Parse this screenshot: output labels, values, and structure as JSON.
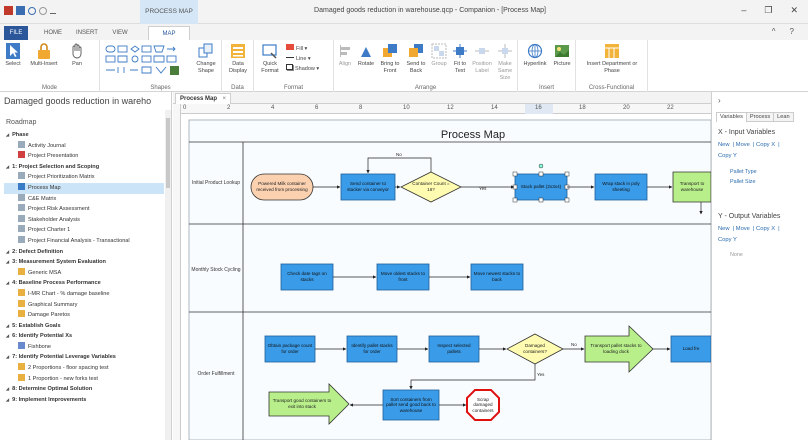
{
  "window": {
    "title": "Damaged goods reduction in warehouse.qcp - Companion - [Process Map]",
    "context_tab": "PROCESS MAP",
    "controls": [
      "–",
      "❐",
      "✕"
    ]
  },
  "ribbon_tabs": [
    "FILE",
    "HOME",
    "INSERT",
    "VIEW",
    "MAP"
  ],
  "ribbon_tabs_right": [
    "^",
    "?"
  ],
  "ribbon": {
    "groups": [
      {
        "label": "Mode",
        "buttons": [
          "Select",
          "Multi-Insert",
          "Pan"
        ]
      },
      {
        "label": "Shapes",
        "buttons": [
          "Change Shape"
        ]
      },
      {
        "label": "Data",
        "buttons": [
          "Data Display"
        ]
      },
      {
        "label": "Format",
        "buttons": [
          "Quick Format",
          "Fill",
          "Line",
          "Shadow"
        ]
      },
      {
        "label": "Arrange",
        "buttons": [
          "Align",
          "Rotate",
          "Bring to Front",
          "Send to Back",
          "Group",
          "Fit to Text",
          "Position Label",
          "Make Same Size"
        ]
      },
      {
        "label": "Insert",
        "buttons": [
          "Hyperlink",
          "Picture"
        ]
      },
      {
        "label": "Cross-Functional",
        "buttons": [
          "Insert Department or Phase"
        ]
      }
    ]
  },
  "left_pane": {
    "title": "Damaged goods reduction in wareho",
    "roadmap_label": "Roadmap",
    "tree": [
      {
        "label": "Phase",
        "level": 0,
        "type": "section"
      },
      {
        "label": "Activity Journal",
        "level": 1,
        "type": "doc"
      },
      {
        "label": "Project Presentation",
        "level": 1,
        "type": "pres"
      },
      {
        "label": "1: Project Selection and Scoping",
        "level": 0,
        "type": "section"
      },
      {
        "label": "Project Prioritization Matrix",
        "level": 1,
        "type": "doc"
      },
      {
        "label": "Process Map",
        "level": 1,
        "type": "map",
        "selected": true
      },
      {
        "label": "C&E Matrix",
        "level": 1,
        "type": "doc"
      },
      {
        "label": "Project Risk Assessment",
        "level": 1,
        "type": "doc"
      },
      {
        "label": "Stakeholder Analysis",
        "level": 1,
        "type": "doc"
      },
      {
        "label": "Project Charter 1",
        "level": 1,
        "type": "doc"
      },
      {
        "label": "Project Financial Analysis - Transactional",
        "level": 1,
        "type": "doc"
      },
      {
        "label": "2: Defect Definition",
        "level": 0,
        "type": "section"
      },
      {
        "label": "3: Measurement System Evaluation",
        "level": 0,
        "type": "section"
      },
      {
        "label": "Generic MSA",
        "level": 1,
        "type": "graph"
      },
      {
        "label": "4: Baseline Process Performance",
        "level": 0,
        "type": "section"
      },
      {
        "label": "I-MR Chart - % damage baseline",
        "level": 1,
        "type": "graph"
      },
      {
        "label": "Graphical Summary",
        "level": 1,
        "type": "graph"
      },
      {
        "label": "Damage Paretos",
        "level": 1,
        "type": "graph"
      },
      {
        "label": "5: Establish Goals",
        "level": 0,
        "type": "section"
      },
      {
        "label": "6: Identify Potential Xs",
        "level": 0,
        "type": "section"
      },
      {
        "label": "Fishbone",
        "level": 1,
        "type": "fish"
      },
      {
        "label": "7: Identify Potential Leverage Variables",
        "level": 0,
        "type": "section"
      },
      {
        "label": "2 Proportions - floor spacing test",
        "level": 1,
        "type": "graph"
      },
      {
        "label": "1 Proportion - new forks test",
        "level": 1,
        "type": "graph"
      },
      {
        "label": "8: Determine Optimal Solution",
        "level": 0,
        "type": "section"
      },
      {
        "label": "9: Implement Improvements",
        "level": 0,
        "type": "section"
      }
    ]
  },
  "document_tab": {
    "label": "Process Map",
    "close": "×"
  },
  "ruler": {
    "numbers": [
      "0",
      "2",
      "4",
      "6",
      "8",
      "10",
      "12",
      "14",
      "16",
      "18",
      "20",
      "22"
    ],
    "highlight": "16"
  },
  "process_map": {
    "title": "Process Map",
    "lanes": [
      "Initial Product Lookup",
      "Monthly Stock Cycling",
      "Order Fulfillment"
    ],
    "shapes": {
      "s1": "Powered Milk container received from processing",
      "s2": "Send container to stacker via conveyor",
      "s3": "Container Count = 16?",
      "s4": "Stack pallet (2x3x4)",
      "s5": "Wrap stack in poly sheeting",
      "s6": "Transport to warehouse",
      "m1": "Check date tags on stacks",
      "m2": "Move oldest stacks to front",
      "m3": "Move newest stacks to back",
      "o1": "Obtain package count for order",
      "o2": "Identify pallet stacks for order",
      "o3": "Inspect selected pallets",
      "o4": "Damaged containers?",
      "o5": "Transport pallet stacks to loading dock",
      "o6": "Load fre",
      "o7": "Transport good containers to exit into stack",
      "o8": "Sort containers from pallet send good back to warehouse",
      "o9": "Scrap damaged containers"
    },
    "connector_labels": {
      "no1": "No",
      "yes1": "Yes",
      "no2": "No",
      "yes2": "Yes"
    }
  },
  "right_pane": {
    "collapse": "›",
    "tabs": [
      "Variables",
      "Process",
      "Lean"
    ],
    "x_section": "X - Input Variables",
    "y_section": "Y - Output Variables",
    "x_actions": [
      "New",
      "Move",
      "Copy X"
    ],
    "x_copy": "Copy Y",
    "x_items": [
      "Pallet Type",
      "Pallet Size"
    ],
    "y_actions": [
      "New",
      "Move",
      "Copy X"
    ],
    "y_copy": "Copy Y",
    "y_items": [
      "None"
    ]
  }
}
